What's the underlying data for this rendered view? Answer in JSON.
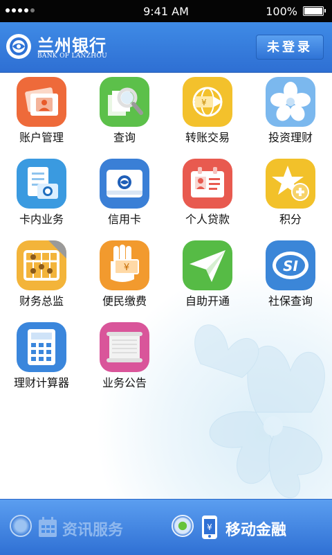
{
  "status_bar": {
    "time": "9:41 AM",
    "battery": "100%"
  },
  "header": {
    "bank_name": "兰州银行",
    "bank_name_en": "BANK OF LANZHOU",
    "login_label": "未登录"
  },
  "grid": [
    {
      "label": "账户管理",
      "icon": "account-card-icon"
    },
    {
      "label": "查询",
      "icon": "magnifier-documents-icon"
    },
    {
      "label": "转账交易",
      "icon": "transfer-globe-icon"
    },
    {
      "label": "投资理财",
      "icon": "flower-icon"
    },
    {
      "label": "卡内业务",
      "icon": "card-document-icon"
    },
    {
      "label": "信用卡",
      "icon": "credit-card-icon"
    },
    {
      "label": "个人贷款",
      "icon": "id-card-icon"
    },
    {
      "label": "积分",
      "icon": "star-plus-icon"
    },
    {
      "label": "财务总监",
      "icon": "abacus-icon"
    },
    {
      "label": "便民缴费",
      "icon": "hand-money-icon"
    },
    {
      "label": "自助开通",
      "icon": "paper-plane-icon"
    },
    {
      "label": "社保查询",
      "icon": "social-security-icon"
    },
    {
      "label": "理财计算器",
      "icon": "calculator-icon"
    },
    {
      "label": "业务公告",
      "icon": "scroll-notice-icon"
    }
  ],
  "bottom_bar": {
    "tab1": {
      "label": "资讯服务",
      "icon": "calendar-icon",
      "active": false
    },
    "tab2": {
      "label": "移动金融",
      "icon": "phone-yen-icon",
      "active": true
    }
  },
  "colors": {
    "header_blue": "#3a82e0",
    "bottom_blue": "#4a8ee6",
    "active_dot": "#67c33a"
  }
}
